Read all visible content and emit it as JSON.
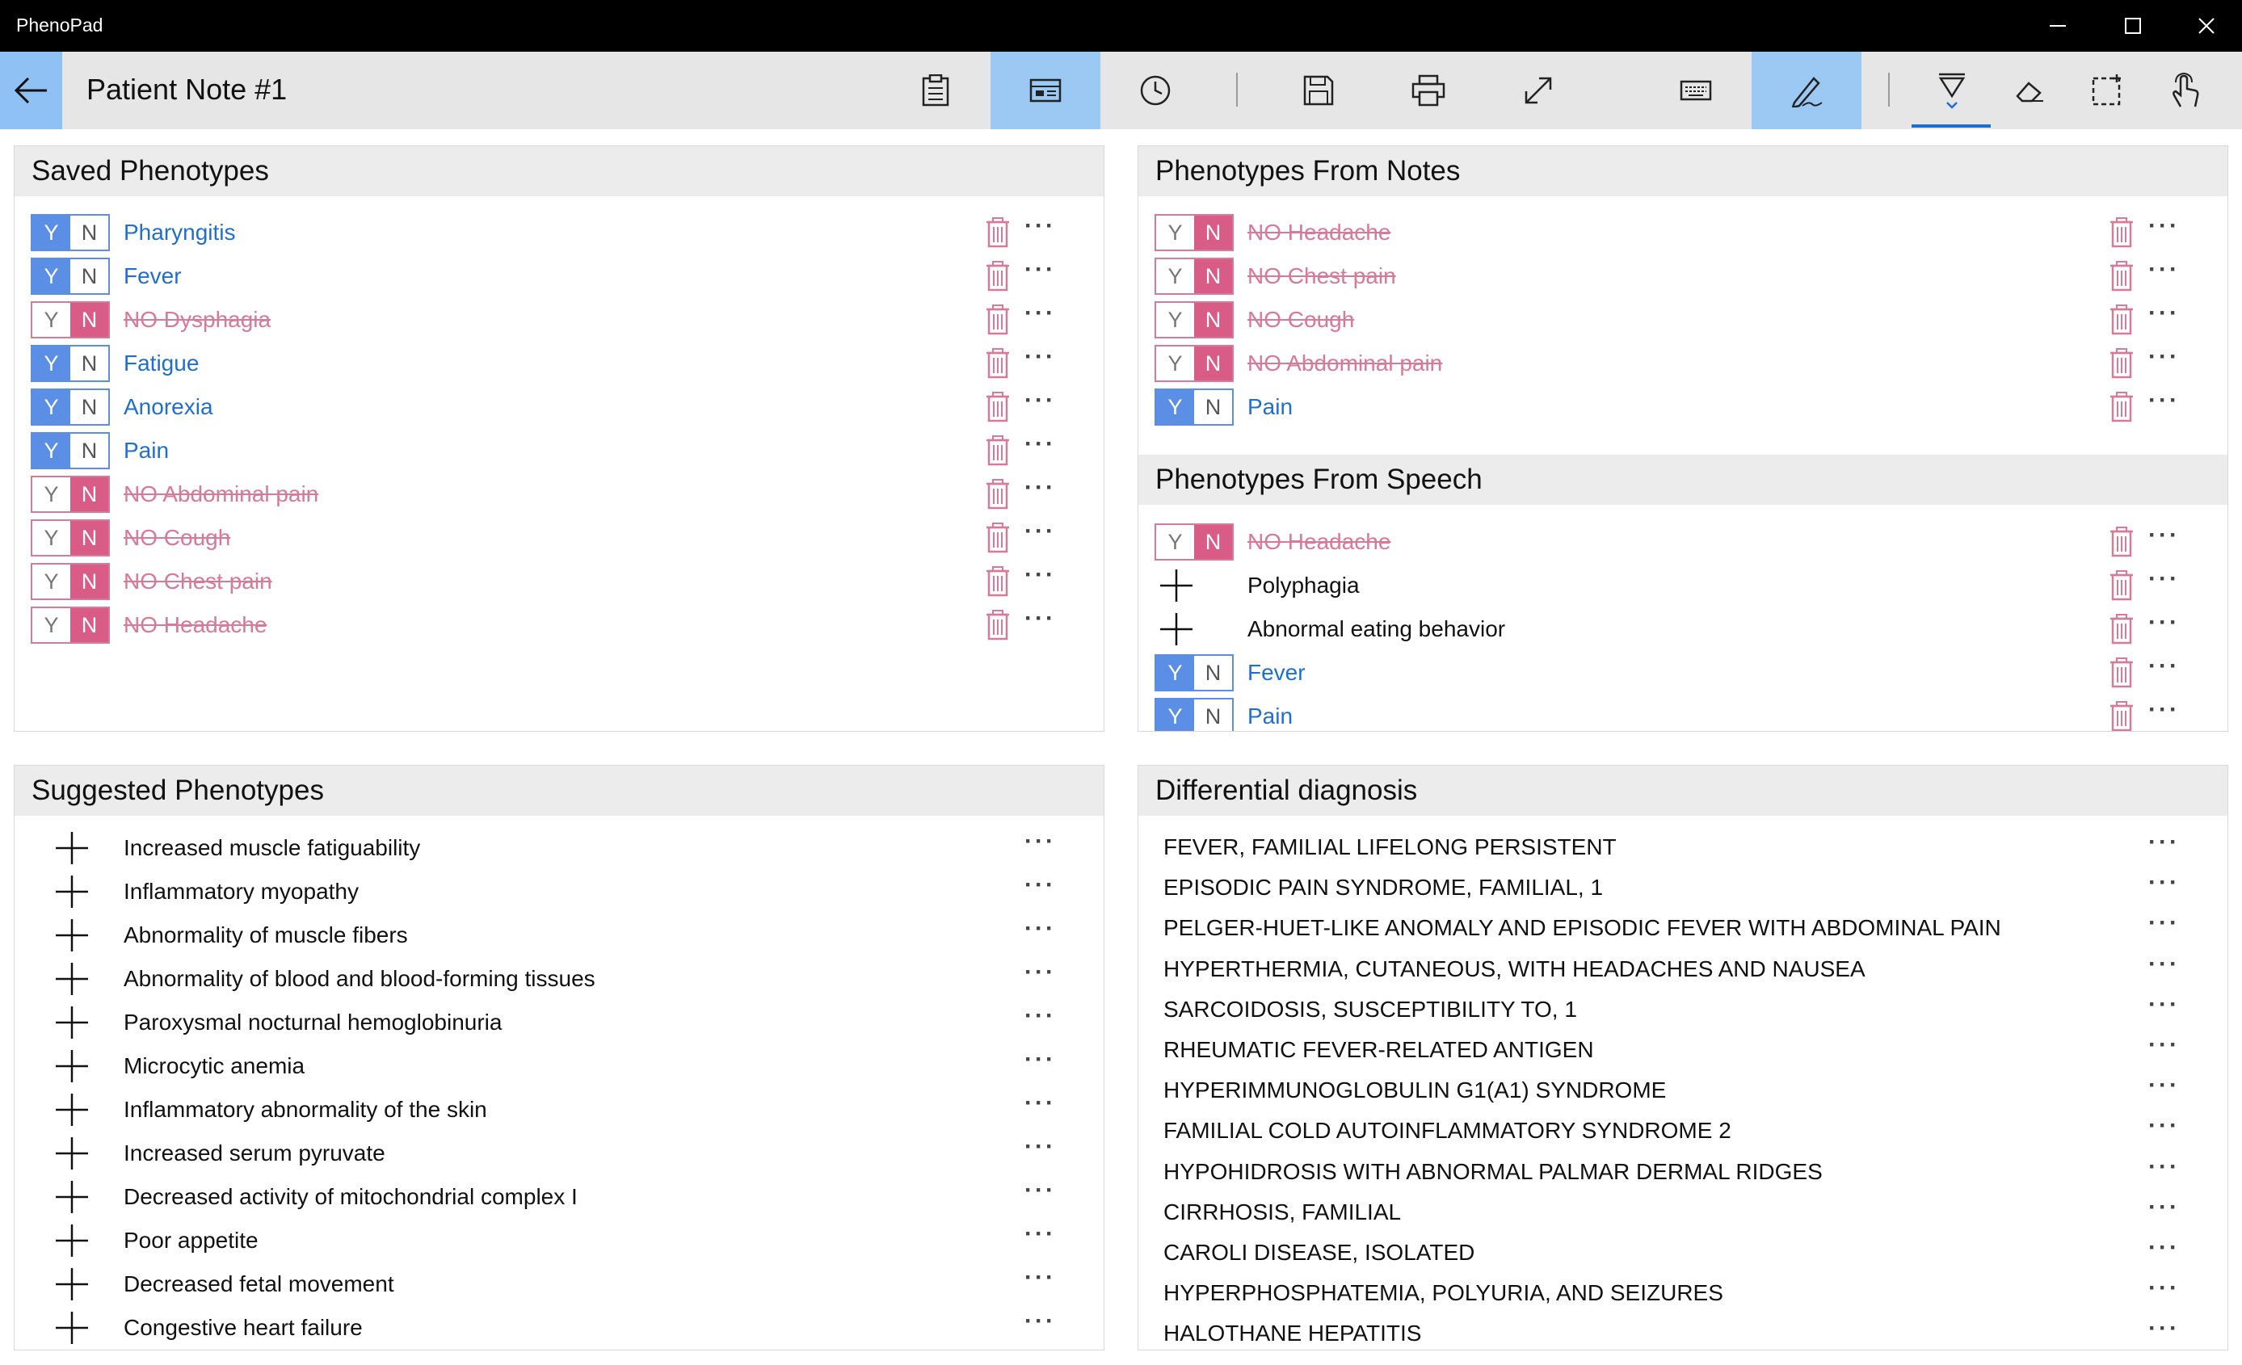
{
  "window": {
    "app_name": "PhenoPad",
    "controls": [
      "minimize-icon",
      "maximize-icon",
      "close-icon"
    ]
  },
  "toolbar": {
    "note_title": "Patient Note #1",
    "buttons": [
      {
        "icon": "clipboard-icon",
        "active": false
      },
      {
        "icon": "phenotype-panel-icon",
        "active": true
      },
      {
        "icon": "clock-icon",
        "active": false
      },
      {
        "icon": "save-icon",
        "active": false
      },
      {
        "icon": "print-icon",
        "active": false
      },
      {
        "icon": "expand-icon",
        "active": false
      },
      {
        "icon": "keyboard-icon",
        "active": false
      },
      {
        "icon": "handwriting-icon",
        "active": true
      },
      {
        "icon": "pen-icon",
        "active": true
      },
      {
        "icon": "eraser-icon",
        "active": false
      },
      {
        "icon": "lasso-select-icon",
        "active": false
      },
      {
        "icon": "touch-icon",
        "active": false
      }
    ],
    "colors": {
      "active_bg": "#9cc8f4",
      "bar_bg": "#e6e6e6"
    }
  },
  "saved": {
    "title": "Saved Phenotypes",
    "items": [
      {
        "label": "Pharyngitis",
        "state": "Y"
      },
      {
        "label": "Fever",
        "state": "Y"
      },
      {
        "label": "NO Dysphagia",
        "state": "N"
      },
      {
        "label": "Fatigue",
        "state": "Y"
      },
      {
        "label": "Anorexia",
        "state": "Y"
      },
      {
        "label": "Pain",
        "state": "Y"
      },
      {
        "label": "NO Abdominal pain",
        "state": "N"
      },
      {
        "label": "NO Cough",
        "state": "N"
      },
      {
        "label": "NO Chest pain",
        "state": "N"
      },
      {
        "label": "NO Headache",
        "state": "N"
      }
    ]
  },
  "notes": {
    "title": "Phenotypes From Notes",
    "items": [
      {
        "label": "NO Headache",
        "state": "N"
      },
      {
        "label": "NO Chest pain",
        "state": "N"
      },
      {
        "label": "NO Cough",
        "state": "N"
      },
      {
        "label": "NO Abdominal pain",
        "state": "N"
      },
      {
        "label": "Pain",
        "state": "Y"
      }
    ]
  },
  "speech": {
    "title": "Phenotypes From Speech",
    "items": [
      {
        "label": "NO Headache",
        "state": "N"
      },
      {
        "label": "Polyphagia",
        "state": "add"
      },
      {
        "label": "Abnormal eating behavior",
        "state": "add"
      },
      {
        "label": "Fever",
        "state": "Y"
      },
      {
        "label": "Pain",
        "state": "Y"
      }
    ]
  },
  "suggested": {
    "title": "Suggested Phenotypes",
    "items": [
      "Increased muscle fatiguability",
      "Inflammatory myopathy",
      "Abnormality of muscle fibers",
      "Abnormality of blood and blood-forming tissues",
      "Paroxysmal nocturnal hemoglobinuria",
      "Microcytic anemia",
      "Inflammatory abnormality of the skin",
      "Increased serum pyruvate",
      "Decreased activity of mitochondrial complex I",
      "Poor appetite",
      "Decreased fetal movement",
      "Congestive heart failure"
    ]
  },
  "differential": {
    "title": "Differential diagnosis",
    "items": [
      "FEVER, FAMILIAL LIFELONG PERSISTENT",
      "EPISODIC PAIN SYNDROME, FAMILIAL, 1",
      "PELGER-HUET-LIKE ANOMALY AND EPISODIC FEVER WITH ABDOMINAL PAIN",
      "HYPERTHERMIA, CUTANEOUS, WITH HEADACHES AND NAUSEA",
      "SARCOIDOSIS, SUSCEPTIBILITY TO, 1",
      "RHEUMATIC FEVER-RELATED ANTIGEN",
      "HYPERIMMUNOGLOBULIN G1(A1) SYNDROME",
      "FAMILIAL COLD AUTOINFLAMMATORY SYNDROME 2",
      "HYPOHIDROSIS WITH ABNORMAL PALMAR DERMAL RIDGES",
      "CIRRHOSIS, FAMILIAL",
      "CAROLI DISEASE, ISOLATED",
      "HYPERPHOSPHATEMIA, POLYURIA, AND SEIZURES",
      "HALOTHANE HEPATITIS"
    ]
  },
  "ui": {
    "yes_label": "Y",
    "no_label": "N",
    "more_label": "···"
  },
  "colors": {
    "positive": "#1f6fd1",
    "negative": "#d77a96",
    "yes_fill": "#5b8fe6",
    "no_fill": "#d85c85"
  }
}
